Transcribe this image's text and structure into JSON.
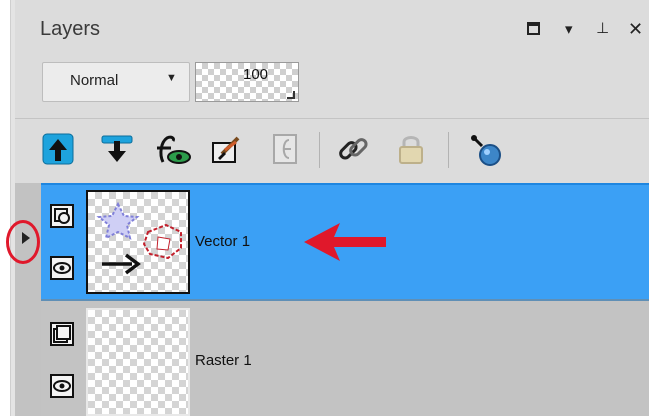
{
  "panel": {
    "title": "Layers",
    "window_controls": [
      {
        "name": "maximize",
        "glyph": ""
      },
      {
        "name": "menu",
        "glyph": "▾"
      },
      {
        "name": "pin",
        "glyph": "⊥"
      },
      {
        "name": "close",
        "glyph": "✕"
      }
    ]
  },
  "blend_mode": {
    "value": "Normal"
  },
  "opacity": {
    "value": "100"
  },
  "toolbar": {
    "tools": [
      {
        "name": "move-layer-up",
        "icon": "arrow-up-icon"
      },
      {
        "name": "move-layer-down",
        "icon": "arrow-down-icon"
      },
      {
        "name": "layer-effects",
        "icon": "fx-eye-icon"
      },
      {
        "name": "edit-selection",
        "icon": "paint-brush-icon"
      },
      {
        "name": "group",
        "icon": "group-icon",
        "disabled": true
      },
      {
        "name": "link-layers",
        "icon": "chain-link-icon"
      },
      {
        "name": "lock-layer",
        "icon": "lock-icon",
        "disabled": true
      },
      {
        "name": "layer-properties",
        "icon": "magnifier-icon"
      }
    ]
  },
  "layers": [
    {
      "name": "Vector 1",
      "type": "vector",
      "selected": true,
      "visible": true,
      "icon": "vector-layer-icon"
    },
    {
      "name": "Raster 1",
      "type": "raster",
      "selected": false,
      "visible": true,
      "icon": "raster-layer-icon"
    }
  ],
  "annotations": {
    "arrow_color": "#e0182b",
    "circle_color": "#e0182b"
  },
  "colors": {
    "selection": "#3ba0f5",
    "panel_bg": "#dcdcdc",
    "layer_bg": "#c3c3c3"
  }
}
